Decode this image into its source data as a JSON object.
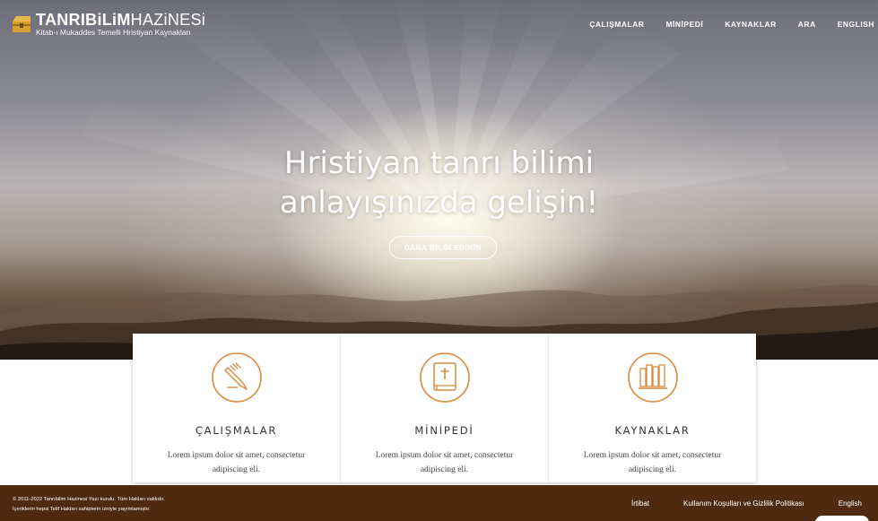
{
  "header": {
    "logo": {
      "title_bold": "TANRIBiLiM",
      "title_light": "HAZiNESi",
      "subtitle": "Kitab-ı Mukaddes Temelli Hristiyan Kaynakları"
    },
    "nav": [
      "ÇALIŞMALAR",
      "MİNİPEDİ",
      "KAYNAKLAR",
      "ARA",
      "ENGLISH"
    ]
  },
  "hero": {
    "title_line1": "Hristiyan tanrı bilimi",
    "title_line2": "anlayışınızda gelişin!",
    "button": "DAHA BİLGİ EDİNİN"
  },
  "cards": [
    {
      "icon": "pencil-hand-icon",
      "title": "ÇALIŞMALAR",
      "text": "Lorem ipsum dolor sit amet, consectetur adipiscing eli."
    },
    {
      "icon": "bible-cross-icon",
      "title": "MİNİPEDİ",
      "text": "Lorem ipsum dolor sit amet, consectetur adipiscing eli."
    },
    {
      "icon": "books-icon",
      "title": "KAYNAKLAR",
      "text": "Lorem ipsum dolor sit amet, consectetur adipiscing eli."
    }
  ],
  "footer": {
    "copyright_line1": "© 2011-2022 Tanrıbilim Hazinesi Yazı kurulu. Tüm Hakları saklıdır.",
    "copyright_line2": "İçeriklerin hepsi Telif Hakları sahiplerin izniyle yayımlamıştır.",
    "links": [
      "İrtibat",
      "Kullanım Koşulları ve Gizlilik Politikası",
      "English"
    ]
  },
  "colors": {
    "accent": "#d78a3c",
    "footer_bg": "#4e2b10"
  }
}
